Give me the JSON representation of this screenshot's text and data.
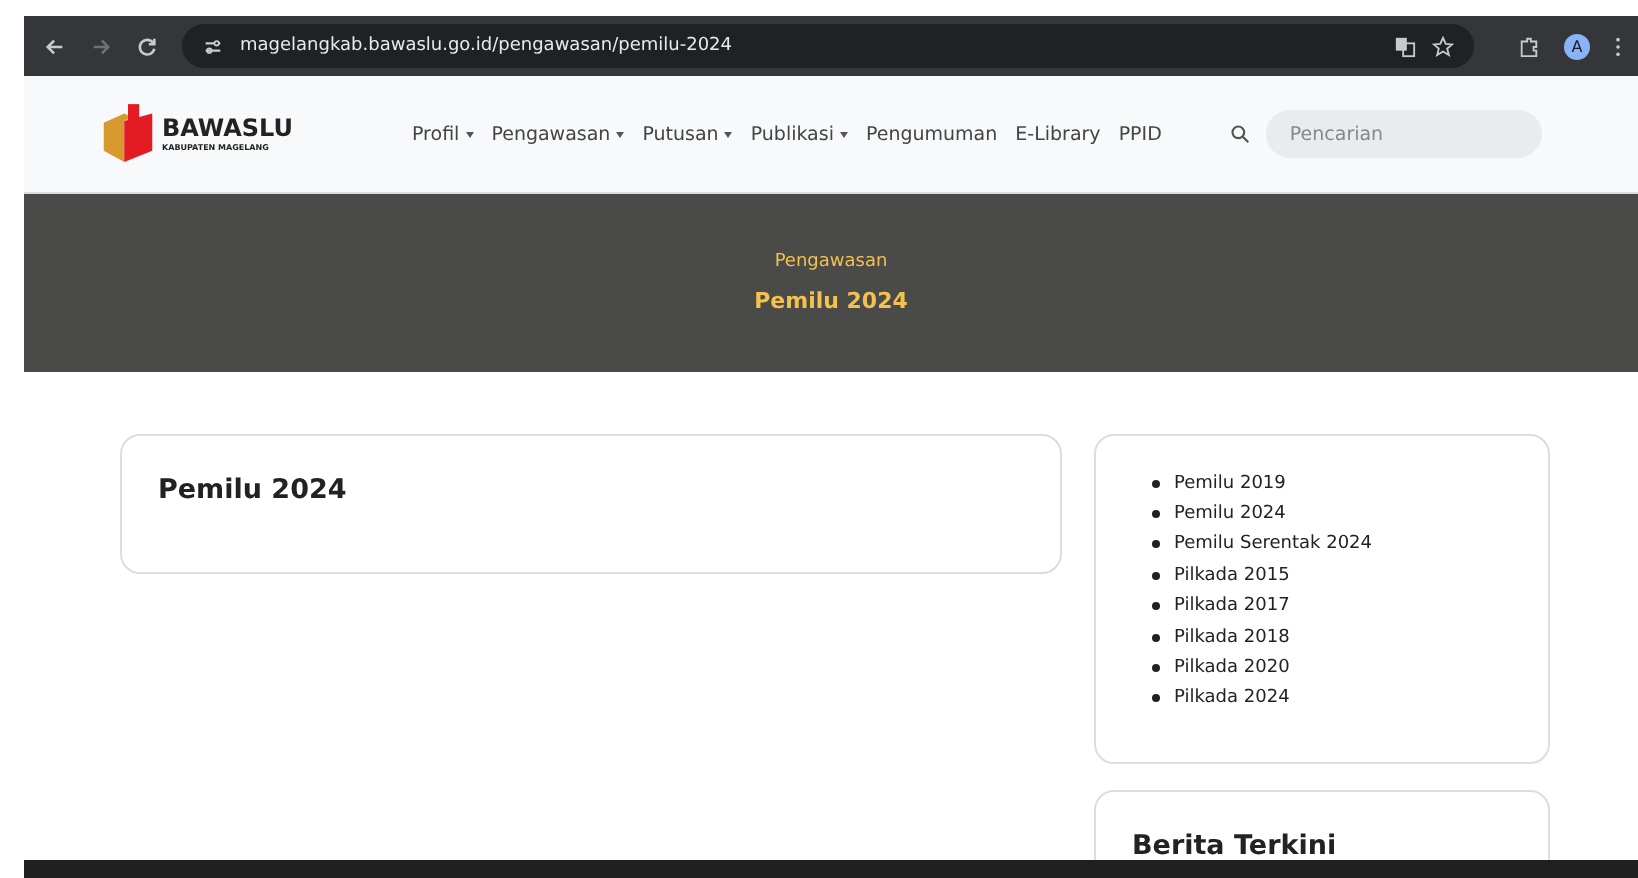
{
  "browser": {
    "url": "magelangkab.bawaslu.go.id/pengawasan/pemilu-2024",
    "profile_initial": "A"
  },
  "site": {
    "logo_title": "BAWASLU",
    "logo_subtitle": "KABUPATEN MAGELANG",
    "nav": [
      {
        "label": "Profil",
        "dropdown": true
      },
      {
        "label": "Pengawasan",
        "dropdown": true
      },
      {
        "label": "Putusan",
        "dropdown": true
      },
      {
        "label": "Publikasi",
        "dropdown": true
      },
      {
        "label": "Pengumuman",
        "dropdown": false
      },
      {
        "label": "E-Library",
        "dropdown": false
      },
      {
        "label": "PPID",
        "dropdown": false
      }
    ],
    "search": {
      "placeholder": "Pencarian"
    }
  },
  "hero": {
    "category": "Pengawasan",
    "title": "Pemilu 2024"
  },
  "main_card": {
    "title": "Pemilu 2024"
  },
  "sidebar": {
    "links": [
      "Pemilu 2019",
      "Pemilu 2024",
      "Pemilu Serentak 2024",
      "Pilkada 2015",
      "Pilkada 2017",
      "Pilkada 2018",
      "Pilkada 2020",
      "Pilkada 2024"
    ],
    "news_title": "Berita Terkini"
  }
}
